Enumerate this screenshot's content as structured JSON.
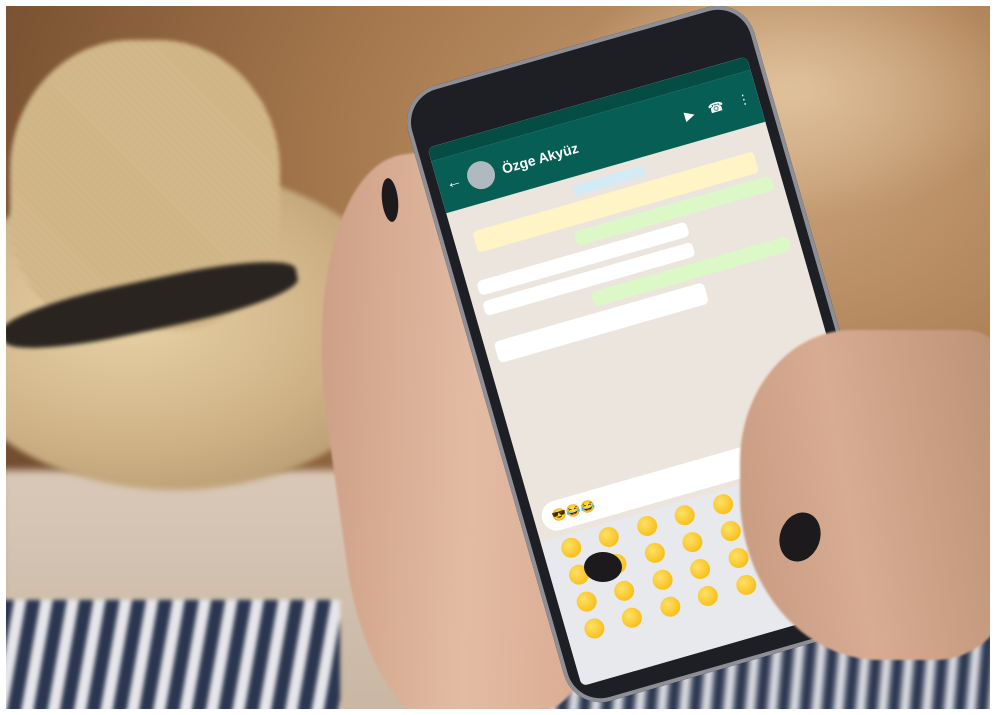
{
  "whatsapp": {
    "contact_name": "Özge Akyüz",
    "input_value": "😎😂😂"
  },
  "colors": {
    "whatsapp_green": "#075e54",
    "send_button": "#00897b",
    "outgoing_bubble": "#dcf8c6"
  }
}
